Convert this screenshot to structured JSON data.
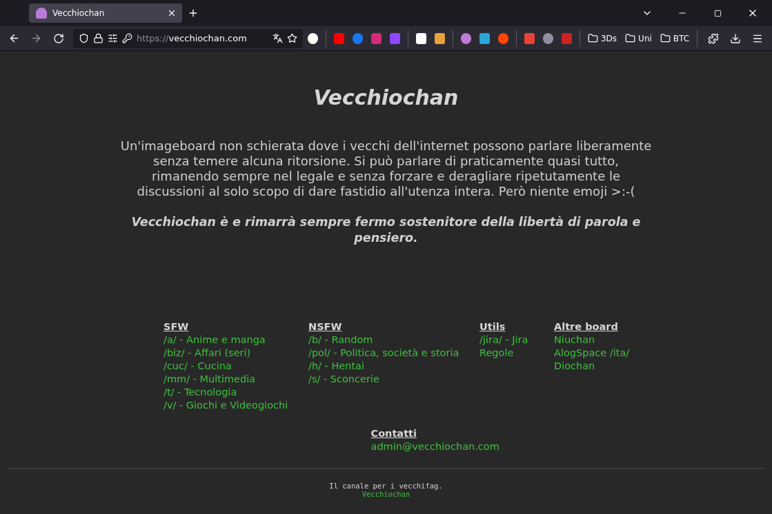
{
  "browser": {
    "tab": {
      "title": "Vecchiochan",
      "selected": true
    },
    "url_scheme": "https://",
    "url_host": "vecchiochan.com",
    "bookmark_folders": [
      {
        "label": "3Ds"
      },
      {
        "label": "Uni"
      },
      {
        "label": "BTC"
      }
    ]
  },
  "page": {
    "title": "Vecchiochan",
    "description": "Un'imageboard non schierata dove i vecchi dell'internet possono parlare liberamente senza temere alcuna ritorsione. Si può parlare di praticamente quasi tutto, rimanendo sempre nel legale e senza forzare e deragliare ripetutamente le discussioni al solo scopo di dare fastidio all'utenza intera. Però niente emoji >:-(",
    "motto": "Vecchiochan è e rimarrà sempre fermo sostenitore della libertà di parola e pensiero.",
    "sections": [
      {
        "heading": "SFW",
        "links": [
          "/a/ - Anime e manga",
          "/biz/ - Affari (seri)",
          "/cuc/ - Cucina",
          "/mm/ - Multimedia",
          "/t/ - Tecnologia",
          "/v/ - Giochi e Videogiochi"
        ]
      },
      {
        "heading": "NSFW",
        "links": [
          "/b/ - Random",
          "/pol/ - Politica, società e storia",
          "/h/ - Hentai",
          "/s/ - Sconcerie"
        ]
      },
      {
        "heading": "Utils",
        "links": [
          "/jira/ - Jira",
          "Regole"
        ]
      },
      {
        "heading": "Altre board",
        "links": [
          "Niuchan",
          "AlogSpace /ita/",
          "Diochan"
        ]
      }
    ],
    "contact": {
      "heading": "Contatti",
      "email": "admin@vecchiochan.com"
    },
    "footer": {
      "tagline": "Il canale per i vecchifag.",
      "link": "Vecchiochan"
    }
  }
}
